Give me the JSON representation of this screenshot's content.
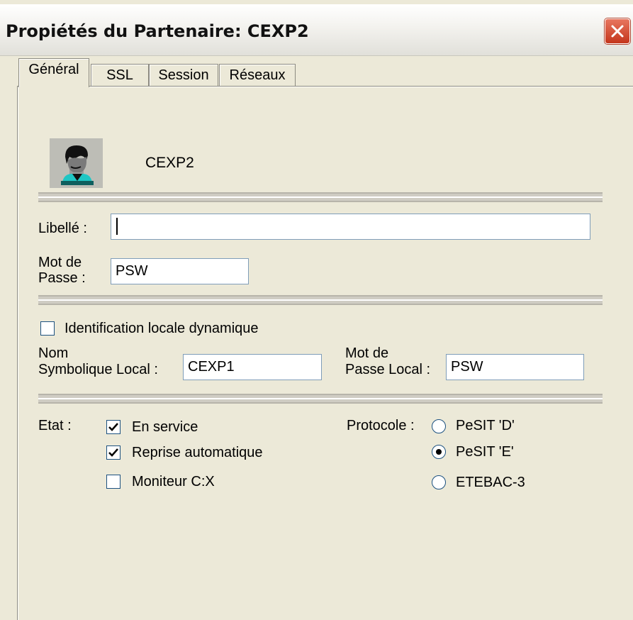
{
  "window": {
    "title": "Propiétés du Partenaire: CEXP2"
  },
  "tabs": [
    {
      "label": "Général",
      "active": true
    },
    {
      "label": "SSL",
      "active": false
    },
    {
      "label": "Session",
      "active": false
    },
    {
      "label": "Réseaux",
      "active": false
    }
  ],
  "partner": {
    "name": "CEXP2",
    "icon": "user-icon"
  },
  "libelle": {
    "label": "Libellé :",
    "value": ""
  },
  "password": {
    "label_line1": "Mot de",
    "label_line2": "Passe :",
    "value": "PSW"
  },
  "dynamic_id": {
    "label": "Identification locale dynamique",
    "checked": false
  },
  "local_name": {
    "label_line1": "Nom",
    "label_line2": "Symbolique Local :",
    "value": "CEXP1"
  },
  "local_password": {
    "label_line1": "Mot de",
    "label_line2": "Passe Local :",
    "value": "PSW"
  },
  "state": {
    "label": "Etat :",
    "options": [
      {
        "label": "En service",
        "checked": true
      },
      {
        "label": "Reprise automatique",
        "checked": true
      },
      {
        "label": "Moniteur C:X",
        "checked": false
      }
    ]
  },
  "protocol": {
    "label": "Protocole :",
    "options": [
      {
        "label": "PeSIT 'D'",
        "selected": false
      },
      {
        "label": "PeSIT 'E'",
        "selected": true
      },
      {
        "label": "ETEBAC-3",
        "selected": false
      }
    ]
  },
  "colors": {
    "face": "#ece9d8",
    "close_button": "#c4361c",
    "field_border": "#7f9db9"
  }
}
